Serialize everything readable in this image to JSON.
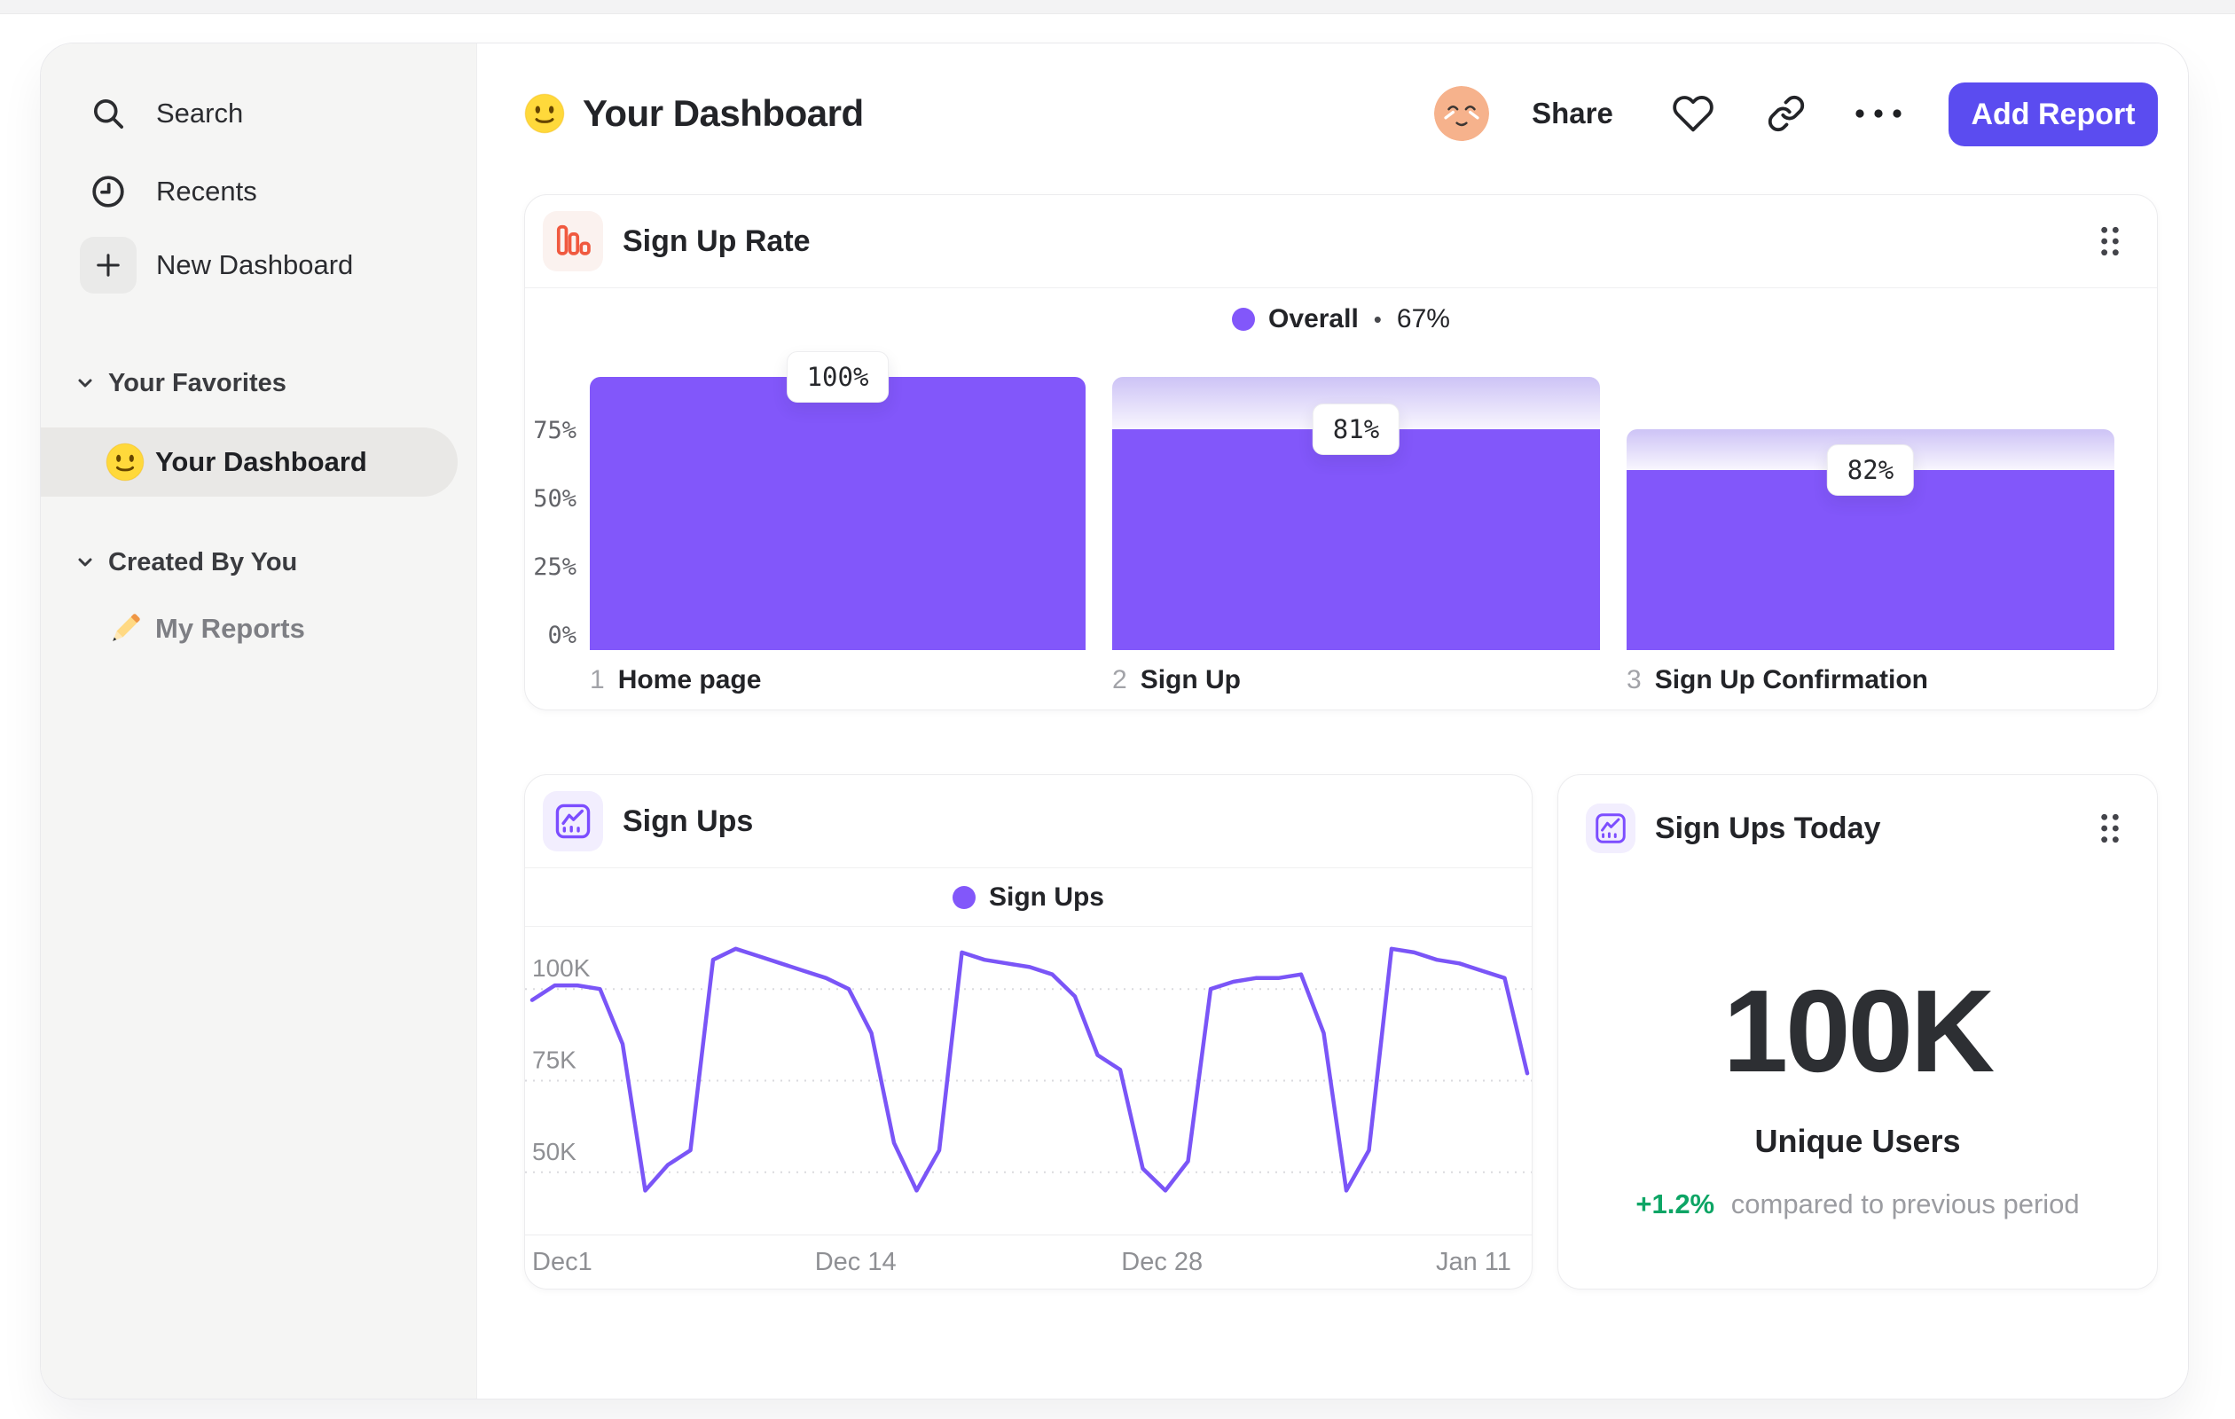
{
  "sidebar": {
    "nav": [
      {
        "label": "Search",
        "icon": "search-icon"
      },
      {
        "label": "Recents",
        "icon": "clock-icon"
      },
      {
        "label": "New Dashboard",
        "icon": "plus-icon"
      }
    ],
    "sections": [
      {
        "label": "Your Favorites",
        "items": [
          {
            "label": "Your Dashboard",
            "icon": "smiley-emoji",
            "selected": true
          }
        ]
      },
      {
        "label": "Created By You",
        "items": [
          {
            "label": "My Reports",
            "icon": "pencil-emoji",
            "selected": false
          }
        ]
      }
    ]
  },
  "header": {
    "title": "Your Dashboard",
    "share_label": "Share",
    "add_report_label": "Add Report"
  },
  "colors": {
    "accent_button": "#5b4cf0",
    "series_purple": "#8257fa",
    "line_purple": "#7a55f7",
    "ghost_gradient_top": "#cdc3f6",
    "ghost_gradient_bottom": "#f8f6fe",
    "positive_green": "#0da565",
    "rate_icon_orange": "#f0593f",
    "chart_icon_purple": "#7c4dff"
  },
  "chart_data": [
    {
      "id": "sign-up-rate",
      "type": "bar",
      "variant": "funnel",
      "title": "Sign Up Rate",
      "legend": {
        "series": "Overall",
        "separator": "•",
        "value": "67%"
      },
      "ylim": [
        0,
        100
      ],
      "grid": false,
      "y_ticks": [
        {
          "label": "75%",
          "value": 75
        },
        {
          "label": "50%",
          "value": 50
        },
        {
          "label": "25%",
          "value": 25
        },
        {
          "label": "0%",
          "value": 0
        }
      ],
      "steps": [
        {
          "index": "1",
          "name": "Home page",
          "step_conversion": "100%",
          "cumulative_pct": 100
        },
        {
          "index": "2",
          "name": "Sign Up",
          "step_conversion": "81%",
          "cumulative_pct": 81
        },
        {
          "index": "3",
          "name": "Sign Up Confirmation",
          "step_conversion": "82%",
          "cumulative_pct": 66
        }
      ]
    },
    {
      "id": "sign-ups",
      "type": "line",
      "title": "Sign Ups",
      "legend": {
        "series": "Sign Ups"
      },
      "ylim_k": [
        33,
        117
      ],
      "unit": "K",
      "grid": "dashed-horizontal",
      "y_gridlines": [
        {
          "label": "100K",
          "value": 100
        },
        {
          "label": "75K",
          "value": 75
        },
        {
          "label": "50K",
          "value": 50
        }
      ],
      "x_ticks": [
        {
          "label": "Dec1",
          "pos": 0.0,
          "align": "left"
        },
        {
          "label": "Dec 14",
          "pos": 0.325,
          "align": "center"
        },
        {
          "label": "Dec 28",
          "pos": 0.633,
          "align": "center"
        },
        {
          "label": "Jan 11",
          "pos": 0.946,
          "align": "center"
        }
      ],
      "values_k": [
        97,
        101,
        101,
        100,
        85,
        45,
        52,
        56,
        108,
        111,
        109,
        107,
        105,
        103,
        100,
        88,
        58,
        45,
        56,
        110,
        108,
        107,
        106,
        104,
        98,
        82,
        78,
        51,
        45,
        53,
        100,
        102,
        103,
        103,
        104,
        88,
        45,
        56,
        111,
        110,
        108,
        107,
        105,
        103,
        77
      ]
    },
    {
      "id": "sign-ups-today",
      "type": "metric",
      "title": "Sign Ups Today",
      "value": "100K",
      "value_label": "Unique Users",
      "delta": "+1.2%",
      "delta_note": "compared to previous period"
    }
  ]
}
